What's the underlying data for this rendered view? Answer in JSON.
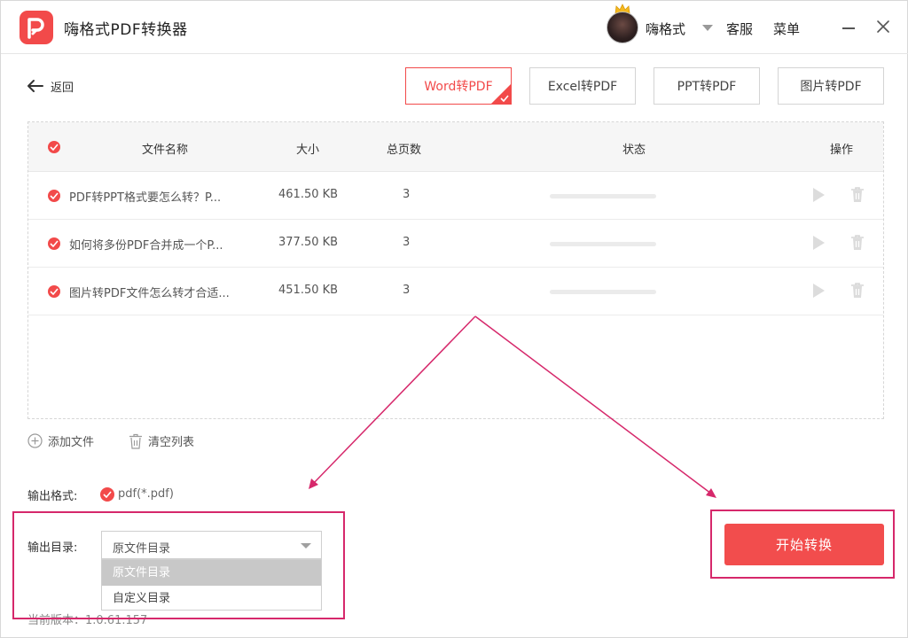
{
  "app": {
    "title": "嗨格式PDF转换器"
  },
  "header": {
    "user_name": "嗨格式",
    "service_label": "客服",
    "menu_label": "菜单"
  },
  "back": {
    "label": "返回"
  },
  "tabs": [
    {
      "label": "Word转PDF",
      "active": true
    },
    {
      "label": "Excel转PDF",
      "active": false
    },
    {
      "label": "PPT转PDF",
      "active": false
    },
    {
      "label": "图片转PDF",
      "active": false
    }
  ],
  "table": {
    "columns": {
      "name": "文件名称",
      "size": "大小",
      "pages": "总页数",
      "status": "状态",
      "actions": "操作"
    },
    "rows": [
      {
        "name": "PDF转PPT格式要怎么转？P...",
        "size": "461.50 KB",
        "pages": "3",
        "progress": 0
      },
      {
        "name": "如何将多份PDF合并成一个P...",
        "size": "377.50 KB",
        "pages": "3",
        "progress": 0
      },
      {
        "name": "图片转PDF文件怎么转才合适...",
        "size": "451.50 KB",
        "pages": "3",
        "progress": 0
      }
    ]
  },
  "actions": {
    "add_file": "添加文件",
    "clear_list": "清空列表"
  },
  "output": {
    "format_label": "输出格式:",
    "format_value": "pdf(*.pdf)",
    "dir_label": "输出目录:",
    "dir_selected": "原文件目录",
    "dir_options": [
      "原文件目录",
      "自定义目录"
    ]
  },
  "start_button": "开始转换",
  "version": "当前版本：1.0.61.157",
  "colors": {
    "accent": "#f24a4a",
    "highlight": "#d6286b"
  }
}
